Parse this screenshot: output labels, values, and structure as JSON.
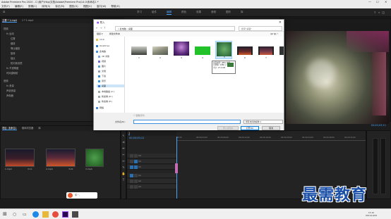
{
  "window": {
    "title": "Adobe Premiere Pro 2020 - C:\\用户\\Hkp\\文档\\Adobe\\Premiere Pro\\14.0\\未命名1 *",
    "controls": [
      "—",
      "☐",
      "✕"
    ]
  },
  "menu": [
    "文件(F)",
    "编辑(E)",
    "剪辑(C)",
    "序列(S)",
    "标记(M)",
    "图形(G)",
    "视图(V)",
    "窗口(W)",
    "帮助(H)"
  ],
  "workspaces": {
    "items": [
      "学习",
      "组件",
      "编辑",
      "颜色",
      "效果",
      "音频",
      "图形",
      "库"
    ],
    "active_index": 2
  },
  "effect_controls": {
    "tabs": [
      "主要 * 1.mp4",
      "1 * 1.mp4"
    ],
    "rows": [
      "视频",
      "fx 运动",
      "位置",
      "缩放",
      "等比缩放",
      "旋转",
      "锚点",
      "防闪烁滤镜",
      "fx 不透明度",
      "时间重映射",
      "音频",
      "fx 音量",
      "声道音量",
      "声像器"
    ]
  },
  "program_monitor": {
    "timecode": "00;00;03;11"
  },
  "project_panel": {
    "tabs": [
      "项目: 未命名1",
      "媒体浏览器",
      "库"
    ],
    "clips": [
      {
        "name": "1.mp4",
        "duration": "3:11"
      },
      {
        "name": "2.mp4",
        "duration": "3:21"
      },
      {
        "name": "3.mp4",
        "duration": ""
      }
    ]
  },
  "timeline": {
    "sequence_tab": "1",
    "timecode": "00;00;00;12",
    "ruler": [
      "00;00",
      "00;00;04;00",
      "00;00;08;00",
      "00;00;12;00",
      "00;00;16;00",
      "00;00;20;00",
      "00;00;24;00",
      "00;00;28;00",
      "00;00;32;00"
    ],
    "tracks": [
      "V3",
      "V2",
      "V1",
      "A1",
      "A2",
      "A3"
    ]
  },
  "dialog": {
    "title": "导入",
    "breadcrumb": "« 此电脑 › 桌面",
    "search_placeholder": "搜索\"桌面\"",
    "organize_label": "组织 ▾",
    "new_folder_label": "新建文件夹",
    "sidebar": [
      {
        "label": "14.0",
        "selected": false
      },
      {
        "label": "OneDrive",
        "selected": false
      },
      {
        "label": "此电脑",
        "selected": false
      },
      {
        "label": "3D 对象",
        "selected": false
      },
      {
        "label": "视频",
        "selected": false
      },
      {
        "label": "图片",
        "selected": false
      },
      {
        "label": "文档",
        "selected": false
      },
      {
        "label": "下载",
        "selected": false
      },
      {
        "label": "音乐",
        "selected": false
      },
      {
        "label": "桌面",
        "selected": true
      },
      {
        "label": "本地磁盘 (C:)",
        "selected": false
      },
      {
        "label": "新加卷 (D:)",
        "selected": false
      },
      {
        "label": "新加卷 (E:)",
        "selected": false
      },
      {
        "label": "网络",
        "selected": false
      }
    ],
    "files": [
      {
        "name": "1",
        "thumb": "road"
      },
      {
        "name": "2",
        "thumb": "street"
      },
      {
        "name": "3",
        "thumb": "purple"
      },
      {
        "name": "4",
        "thumb": "green"
      },
      {
        "name": "5",
        "thumb": "greenimg"
      },
      {
        "name": "6",
        "thumb": "film1"
      },
      {
        "name": "7",
        "thumb": "film2"
      },
      {
        "name": "8",
        "thumb": "film3"
      }
    ],
    "tooltip": {
      "line1": "项目类型: JPEG 文件",
      "line2": "分辨率: 1080 x 1070",
      "line3": "大小: 27.0 KB"
    },
    "image_sequence_label": "图像序列",
    "filename_label": "文件名(N):",
    "filename_value": "",
    "filetype_value": "所有支持的媒体",
    "import_folder_label": "导入文件夹",
    "open_label": "打开(O)",
    "cancel_label": "取消"
  },
  "taskbar": {
    "time": "15:16",
    "date": "2021/10/29"
  },
  "ime": {
    "label": "中 ·,"
  },
  "watermark": "最需教育",
  "colors": {
    "accent": "#4aa3ff",
    "premiere_purple": "#9a4dff",
    "watermark": "#1a4fa8"
  }
}
